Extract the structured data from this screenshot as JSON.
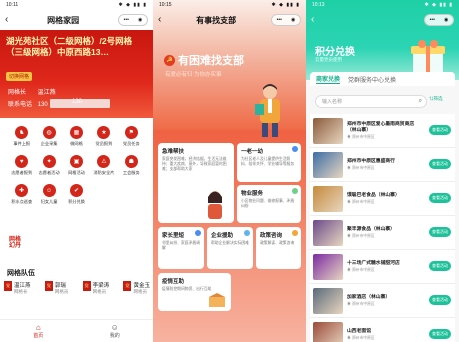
{
  "colors": {
    "party_red": "#d3261a",
    "mint": "#1ec29a"
  },
  "p1": {
    "status": {
      "time": "10:11",
      "icons": "✱ ◆ ▮▮ ▮"
    },
    "nav": {
      "back": "‹",
      "title": "网格家园",
      "capsule_more": "•••",
      "capsule_close": "◉"
    },
    "hero": {
      "title": "湖光苑社区（二级网格）/2号网格（三级网格）中原西路13…",
      "tag": "切换网格",
      "leader_label": "网格长",
      "leader_name": "温江燕",
      "phone_label": "联系电话",
      "phone_prefix": "130",
      "phone_suffix": "130"
    },
    "grid": [
      {
        "icon": "♞",
        "label": "事件上报"
      },
      {
        "icon": "◍",
        "label": "企业采集"
      },
      {
        "icon": "▦",
        "label": "微网格"
      },
      {
        "icon": "★",
        "label": "党员报到"
      },
      {
        "icon": "⚑",
        "label": "党员任务"
      },
      {
        "icon": "♥",
        "label": "志愿者报到"
      },
      {
        "icon": "✦",
        "label": "志愿者活动"
      },
      {
        "icon": "▣",
        "label": "网格活动"
      },
      {
        "icon": "⚠",
        "label": "消防安全片"
      },
      {
        "icon": "☗",
        "label": "工会服务"
      },
      {
        "icon": "✚",
        "label": "积水点巡查"
      },
      {
        "icon": "☺",
        "label": "妇女儿童"
      },
      {
        "icon": "✔",
        "label": "积分兑换"
      }
    ],
    "logo_line1": "网格",
    "logo_line2": "幻丹",
    "section_title": "网格队伍",
    "people": [
      {
        "badge": "党",
        "name": "温江燕",
        "role": "网格长"
      },
      {
        "badge": "党",
        "name": "郭瑞",
        "role": "网格员"
      },
      {
        "badge": "党",
        "name": "李梁涛",
        "role": "网格员"
      },
      {
        "badge": "党",
        "name": "黄金玉",
        "role": "网格员"
      }
    ],
    "tabs": [
      {
        "icon": "⌂",
        "label": "首页"
      },
      {
        "icon": "☺",
        "label": "我的"
      }
    ]
  },
  "p2": {
    "status": {
      "time": "10:15",
      "icons": "✱ ◆ ▮▮ ▮"
    },
    "nav": {
      "back": "‹",
      "title": "有事找支部",
      "capsule_more": "•••",
      "capsule_close": "◉"
    },
    "hero": {
      "emblem": "☭",
      "title": "有困难找支部",
      "subtitle": "有爱必有归  为你办实事"
    },
    "tiles": [
      {
        "title": "急难帮扶",
        "desc": "家庭突发困难，经济拮据，生活无法维持；重大疾病、意外，导致家庭暂时困难；支部帮助大家"
      },
      {
        "title": "一老一幼",
        "desc": "为社区老人及儿童提供生活照料、陪伴关怀、学业辅导等服务"
      },
      {
        "title": "物业服务",
        "desc": "小区物业问题、维修报事、矛盾纠纷"
      },
      {
        "title": "家长里短",
        "desc": "邻里纠纷、家庭矛盾调解"
      },
      {
        "title": "企业援助",
        "desc": "帮助企业解决实际困难"
      },
      {
        "title": "政策咨询",
        "desc": "政策解读、政策咨询"
      },
      {
        "title": "疫情互助",
        "desc": "疫情防控期间物资、出行互助"
      }
    ]
  },
  "p3": {
    "status": {
      "time": "10:13",
      "icons": "✱ ◆ ▮▮ ▮"
    },
    "nav": {
      "back": "‹",
      "capsule_more": "•••",
      "capsule_close": "◉"
    },
    "title": "积分兑换",
    "subtitle": "云量党员使用",
    "tabs": [
      {
        "label": "商家兑换",
        "active": true
      },
      {
        "label": "党群服务中心兑换",
        "active": false
      }
    ],
    "search": {
      "placeholder": "输入名称",
      "icon": "⌕",
      "filter": "⇅筛选"
    },
    "shops": [
      {
        "name": "郑州市中原区爱心墨雨商贸商店（林山寨）",
        "addr": "◉ 郑州市中原区",
        "btn": "查看活动",
        "color": "#8a5a3a"
      },
      {
        "name": "郑州市中原区惠盛商行",
        "addr": "◉ 郑州市中原区",
        "btn": "查看活动",
        "color": "#3a6ea5"
      },
      {
        "name": "馍聪巴老食品（林山寨）",
        "addr": "◉ 郑州市中原区",
        "btn": "查看活动",
        "color": "#c58a3a"
      },
      {
        "name": "聚丰源食品（林山寨）",
        "addr": "◉ 郑州市中原区",
        "btn": "查看活动",
        "color": "#6a4a8a"
      },
      {
        "name": "十三场广式糖水铺甜河店",
        "addr": "◉ 郑州市中原区",
        "btn": "查看活动",
        "color": "#7a2aa0"
      },
      {
        "name": "加家酒店（林山寨）",
        "addr": "◉ 郑州市中原区",
        "btn": "查看活动",
        "color": "#5a6a7a"
      },
      {
        "name": "山西老面馆",
        "addr": "◉ 郑州市中原区",
        "btn": "查看活动",
        "color": "#9a4a3a"
      }
    ]
  }
}
